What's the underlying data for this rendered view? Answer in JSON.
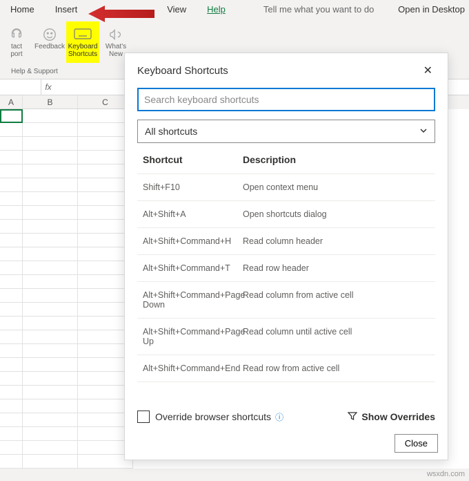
{
  "ribbon": {
    "tabs": {
      "home": "Home",
      "insert": "Insert",
      "view": "View",
      "help": "Help"
    },
    "tell_me": "Tell me what you want to do",
    "open_desktop": "Open in Desktop",
    "buttons": {
      "contact_support_l1": "tact",
      "contact_support_l2": "port",
      "feedback": "Feedback",
      "keyboard_shortcuts_l1": "Keyboard",
      "keyboard_shortcuts_l2": "Shortcuts",
      "whats_new_l1": "What's",
      "whats_new_l2": "New"
    },
    "group_label": "Help & Support"
  },
  "formula_bar": {
    "fx": "fx"
  },
  "columns": [
    "A",
    "B",
    "C"
  ],
  "dialog": {
    "title": "Keyboard Shortcuts",
    "search_placeholder": "Search keyboard shortcuts",
    "filter": "All shortcuts",
    "col_shortcut": "Shortcut",
    "col_description": "Description",
    "rows": [
      {
        "shortcut": "Shift+F10",
        "desc": "Open context menu"
      },
      {
        "shortcut": "Alt+Shift+A",
        "desc": "Open shortcuts dialog"
      },
      {
        "shortcut": "Alt+Shift+Command+H",
        "desc": "Read column header"
      },
      {
        "shortcut": "Alt+Shift+Command+T",
        "desc": "Read row header"
      },
      {
        "shortcut": "Alt+Shift+Command+Page Down",
        "desc": "Read column from active cell"
      },
      {
        "shortcut": "Alt+Shift+Command+Page Up",
        "desc": "Read column until active cell"
      },
      {
        "shortcut": "Alt+Shift+Command+End",
        "desc": "Read row from active cell"
      }
    ],
    "override_label": "Override browser shortcuts",
    "show_overrides": "Show Overrides",
    "close": "Close"
  },
  "watermark": "wsxdn.com"
}
